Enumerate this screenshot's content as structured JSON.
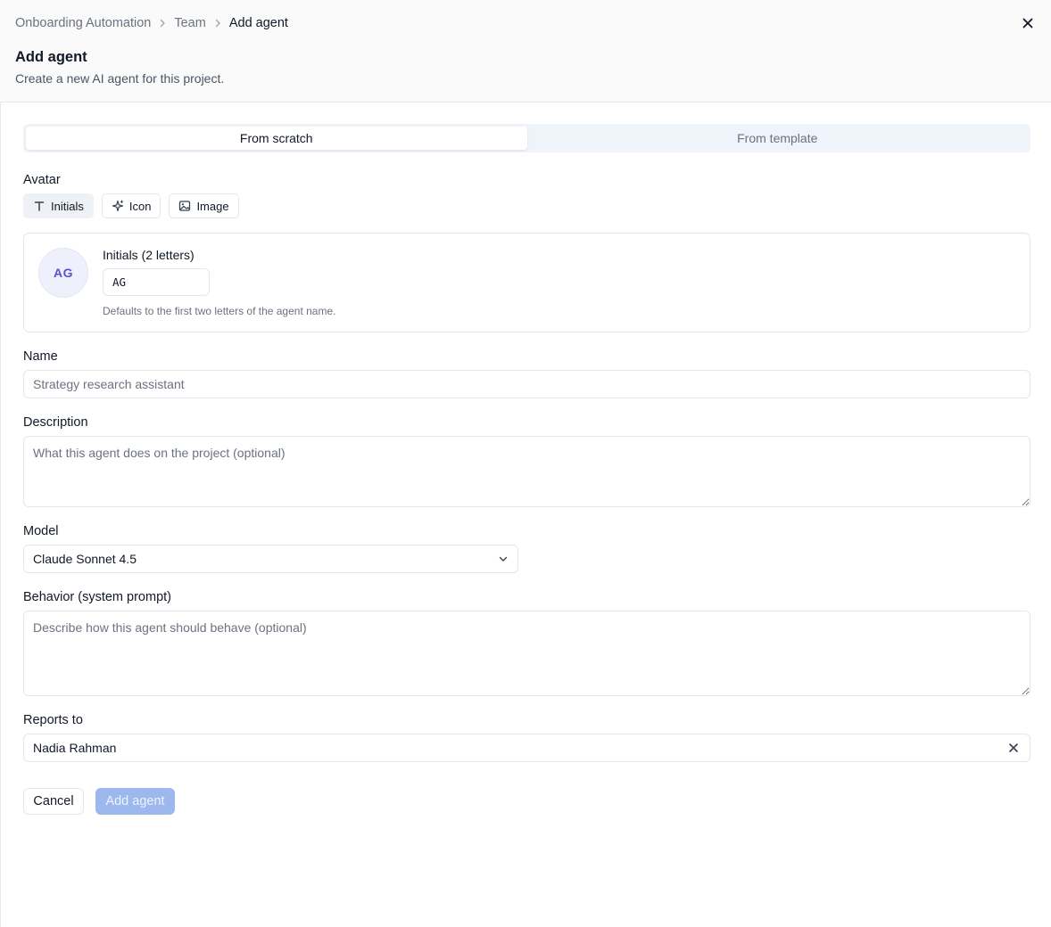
{
  "breadcrumb": {
    "items": [
      "Onboarding Automation",
      "Team",
      "Add agent"
    ]
  },
  "header": {
    "title": "Add agent",
    "subtitle": "Create a new AI agent for this project."
  },
  "mode_tabs": [
    {
      "label": "From scratch",
      "active": true
    },
    {
      "label": "From template",
      "active": false
    }
  ],
  "avatar": {
    "label": "Avatar",
    "tabs": [
      {
        "label": "Initials",
        "icon": "type-icon",
        "active": true
      },
      {
        "label": "Icon",
        "icon": "sparkles-icon",
        "active": false
      },
      {
        "label": "Image",
        "icon": "image-icon",
        "active": false
      }
    ],
    "preview": "AG",
    "initials_label": "Initials (2 letters)",
    "initials_value": "AG",
    "initials_hint": "Defaults to the first two letters of the agent name.",
    "accent_color": "#5b4fd6"
  },
  "name": {
    "label": "Name",
    "placeholder": "Strategy research assistant"
  },
  "description": {
    "label": "Description",
    "placeholder": "What this agent does on the project (optional)"
  },
  "model": {
    "label": "Model",
    "selected": "Claude Sonnet 4.5"
  },
  "behavior": {
    "label": "Behavior (system prompt)",
    "placeholder": "Describe how this agent should behave (optional)"
  },
  "reports_to": {
    "label": "Reports to",
    "selected": "Nadia Rahman"
  },
  "actions": {
    "cancel_label": "Cancel",
    "submit_label": "Add agent",
    "submit_color": "#9cb8ef"
  }
}
